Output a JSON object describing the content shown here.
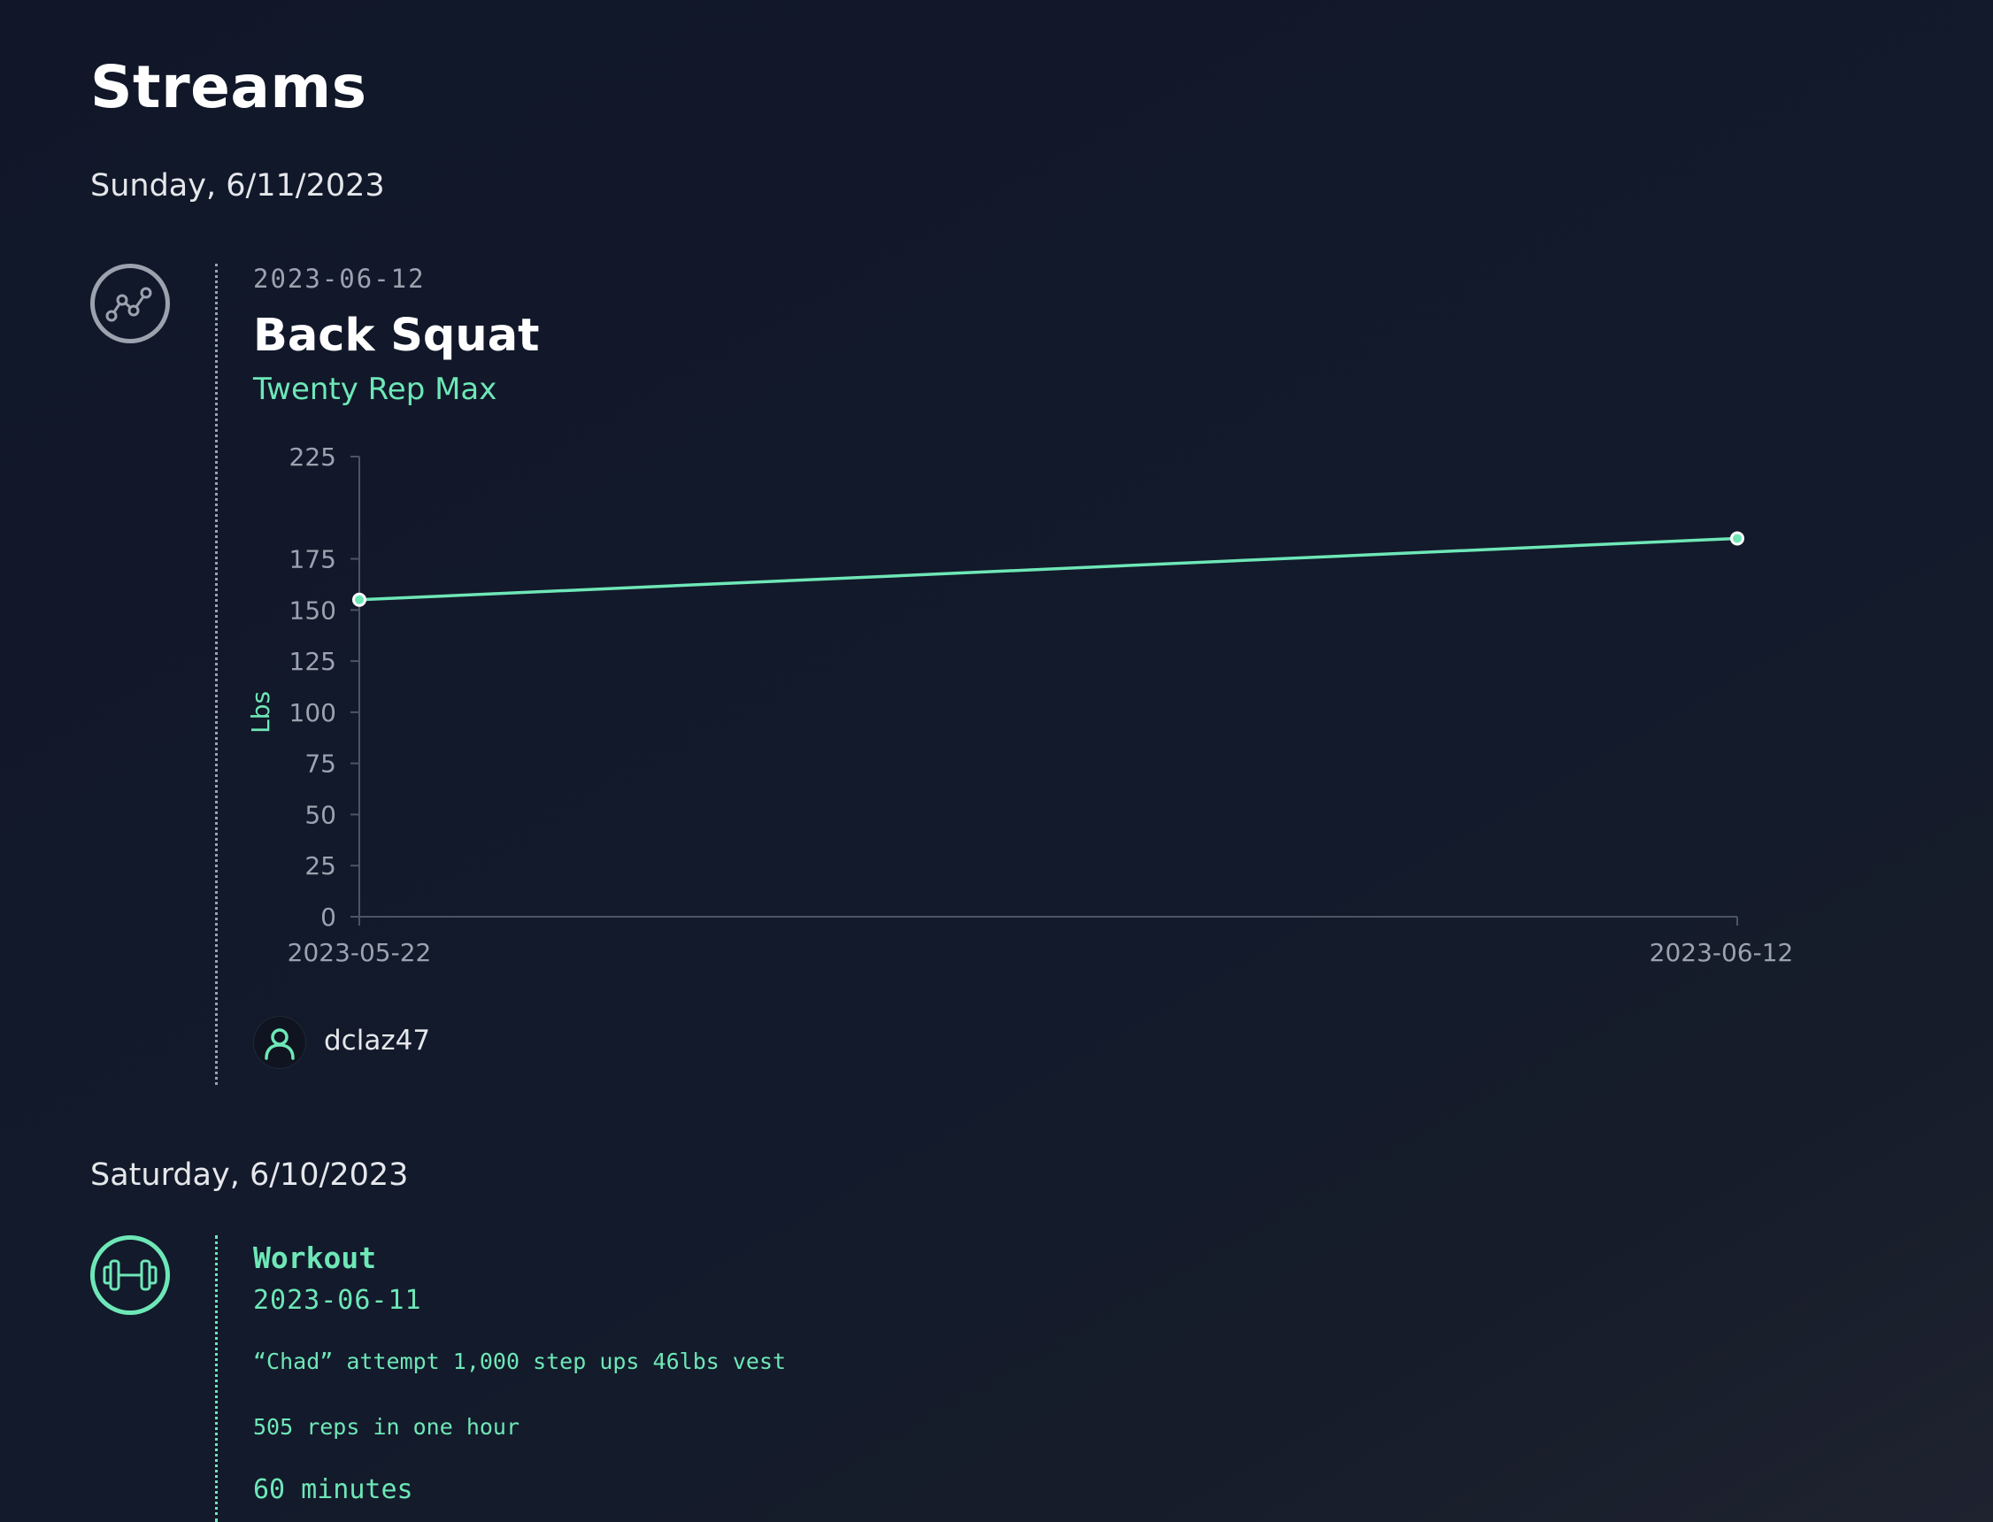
{
  "page": {
    "title": "Streams"
  },
  "days": [
    {
      "label": "Sunday, 6/11/2023",
      "entry": {
        "icon": "line-chart-icon",
        "date": "2023-06-12",
        "title": "Back Squat",
        "subtitle": "Twenty Rep Max",
        "user": {
          "icon": "user-icon",
          "name": "dclaz47"
        }
      }
    },
    {
      "label": "Saturday, 6/10/2023",
      "entry": {
        "icon": "dumbbell-icon",
        "type_label": "Workout",
        "date": "2023-06-11",
        "lines": [
          "“Chad” attempt 1,000 step ups 46lbs vest",
          "505 reps in one hour"
        ],
        "duration": "60 minutes"
      }
    }
  ],
  "colors": {
    "accent": "#6ee7b7",
    "muted": "#9ca3af",
    "background": "#111729"
  },
  "chart_data": {
    "type": "line",
    "title": "",
    "ylabel": "Lbs",
    "xlabel": "",
    "x": [
      "2023-05-22",
      "2023-06-12"
    ],
    "x_tick_labels": [
      "2023-05-22",
      "2023-06-12"
    ],
    "series": [
      {
        "values": [
          155,
          185
        ]
      }
    ],
    "y_ticks": [
      0,
      25,
      50,
      75,
      100,
      125,
      150,
      175,
      225
    ],
    "ylim": [
      0,
      225
    ],
    "grid": false,
    "legend": "none",
    "color": "#6ee7b7"
  }
}
